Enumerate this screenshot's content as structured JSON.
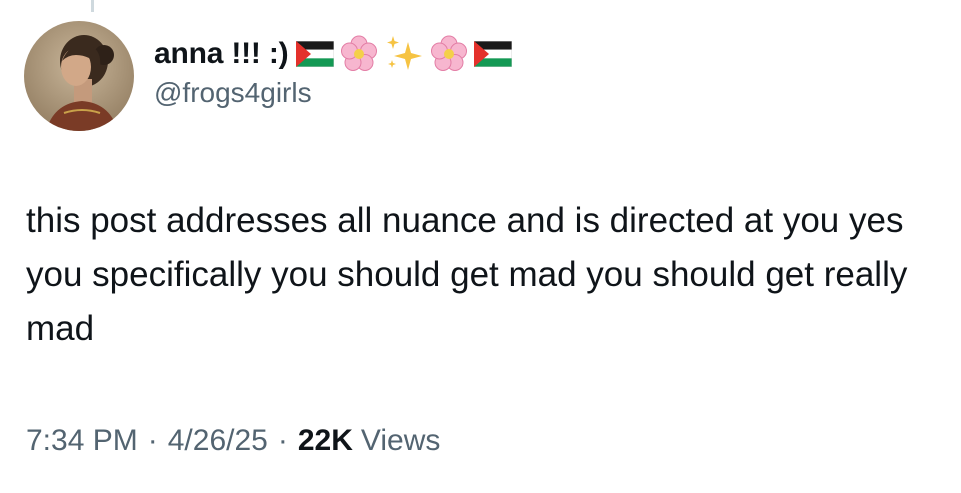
{
  "tweet": {
    "author": {
      "display_name": "anna !!! :)",
      "handle": "@frogs4girls",
      "name_emojis": [
        "palestine-flag",
        "cherry-blossom",
        "sparkles",
        "cherry-blossom",
        "palestine-flag"
      ]
    },
    "text": "this post addresses all nuance and is directed at you yes you specifically you should get mad you should get really mad",
    "time": "7:34 PM",
    "separator": "·",
    "date": "4/26/25",
    "views_count": "22K",
    "views_label": "Views"
  },
  "colors": {
    "primary_text": "#0f1419",
    "secondary_text": "#536471",
    "background": "#ffffff",
    "thread_line": "#cfd9de"
  }
}
